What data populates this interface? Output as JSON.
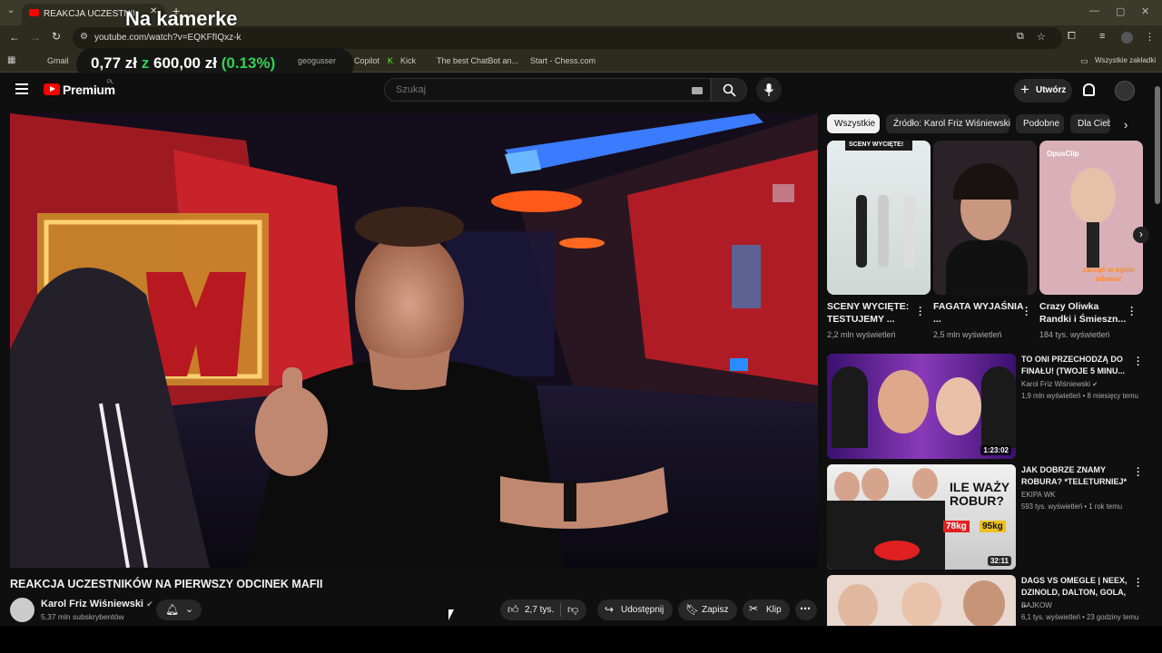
{
  "browser": {
    "tab_title": "REAKCJA UCZESTNIKÓW N",
    "overlay_title": "Na kamerke",
    "url": "youtube.com/watch?v=EQKFfIQxz-k",
    "bookmarks": [
      "Gmail",
      "Copilot",
      "Kick",
      "The best ChatBot an...",
      "Start - Chess.com"
    ],
    "all_bookmarks": "Wszystkie zakładki",
    "price_text_a": "0,77 zł",
    "price_sep": "z",
    "price_text_b": "600,00 zł",
    "price_pct": "(0.13%)",
    "price_src": "geogusser"
  },
  "header": {
    "logo_text": "Premium",
    "logo_region": "PL",
    "search_placeholder": "Szukaj",
    "create_label": "Utwórz"
  },
  "video": {
    "title": "REAKCJA UCZESTNIKÓW NA PIERWSZY ODCINEK MAFII",
    "channel": "Karol Friz Wiśniewski",
    "subscribers": "5,37 mln subskrybentów",
    "likes": "2,7 tys.",
    "share": "Udostępnij",
    "save": "Zapisz",
    "clip": "Klip"
  },
  "chips": [
    "Wszystkie",
    "Źródło: Karol Friz Wiśniewski",
    "Podobne",
    "Dla Ciebie"
  ],
  "shorts": [
    {
      "title": "SCENY WYCIĘTE: TESTUJEMY ...",
      "views": "2,2 mln wyświetleń",
      "badge": "SCENY WYCIĘTE!"
    },
    {
      "title": "FAGATA WYJAŚNIA ...",
      "views": "2,5 mln wyświetleń"
    },
    {
      "title": "Crazy Oliwka Randki i Śmieszn...",
      "views": "184 tys. wyświetleń",
      "badge": "OpusClip",
      "caption": "zacząć w ogóle udawać"
    }
  ],
  "recommended": [
    {
      "title": "TO ONI PRZECHODZĄ DO FINAŁU! (TWOJE 5 MINU...",
      "channel": "Karol Friz Wiśniewski",
      "meta": "1,9 mln wyświetleń • 8 miesięcy temu",
      "duration": "1:23:02"
    },
    {
      "title": "JAK DOBRZE ZNAMY ROBURA? *TELETURNIEJ*",
      "channel": "EKIPA WK",
      "meta": "593 tys. wyświetleń • 1 rok temu",
      "duration": "32:11",
      "thumb_text": "ILE WAŻY ROBUR?",
      "tag_a": "78kg",
      "tag_b": "95kg"
    },
    {
      "title": "DAGS VS OMEGLE | NEEX, DZINOLD, DALTON, GOLA, ...",
      "channel": "BAJKOW",
      "meta": "6,1 tys. wyświetleń • 23 godziny temu"
    }
  ],
  "colors": {
    "accent": "#ff0000",
    "bg": "#0f0f0f",
    "pill": "#272727"
  }
}
